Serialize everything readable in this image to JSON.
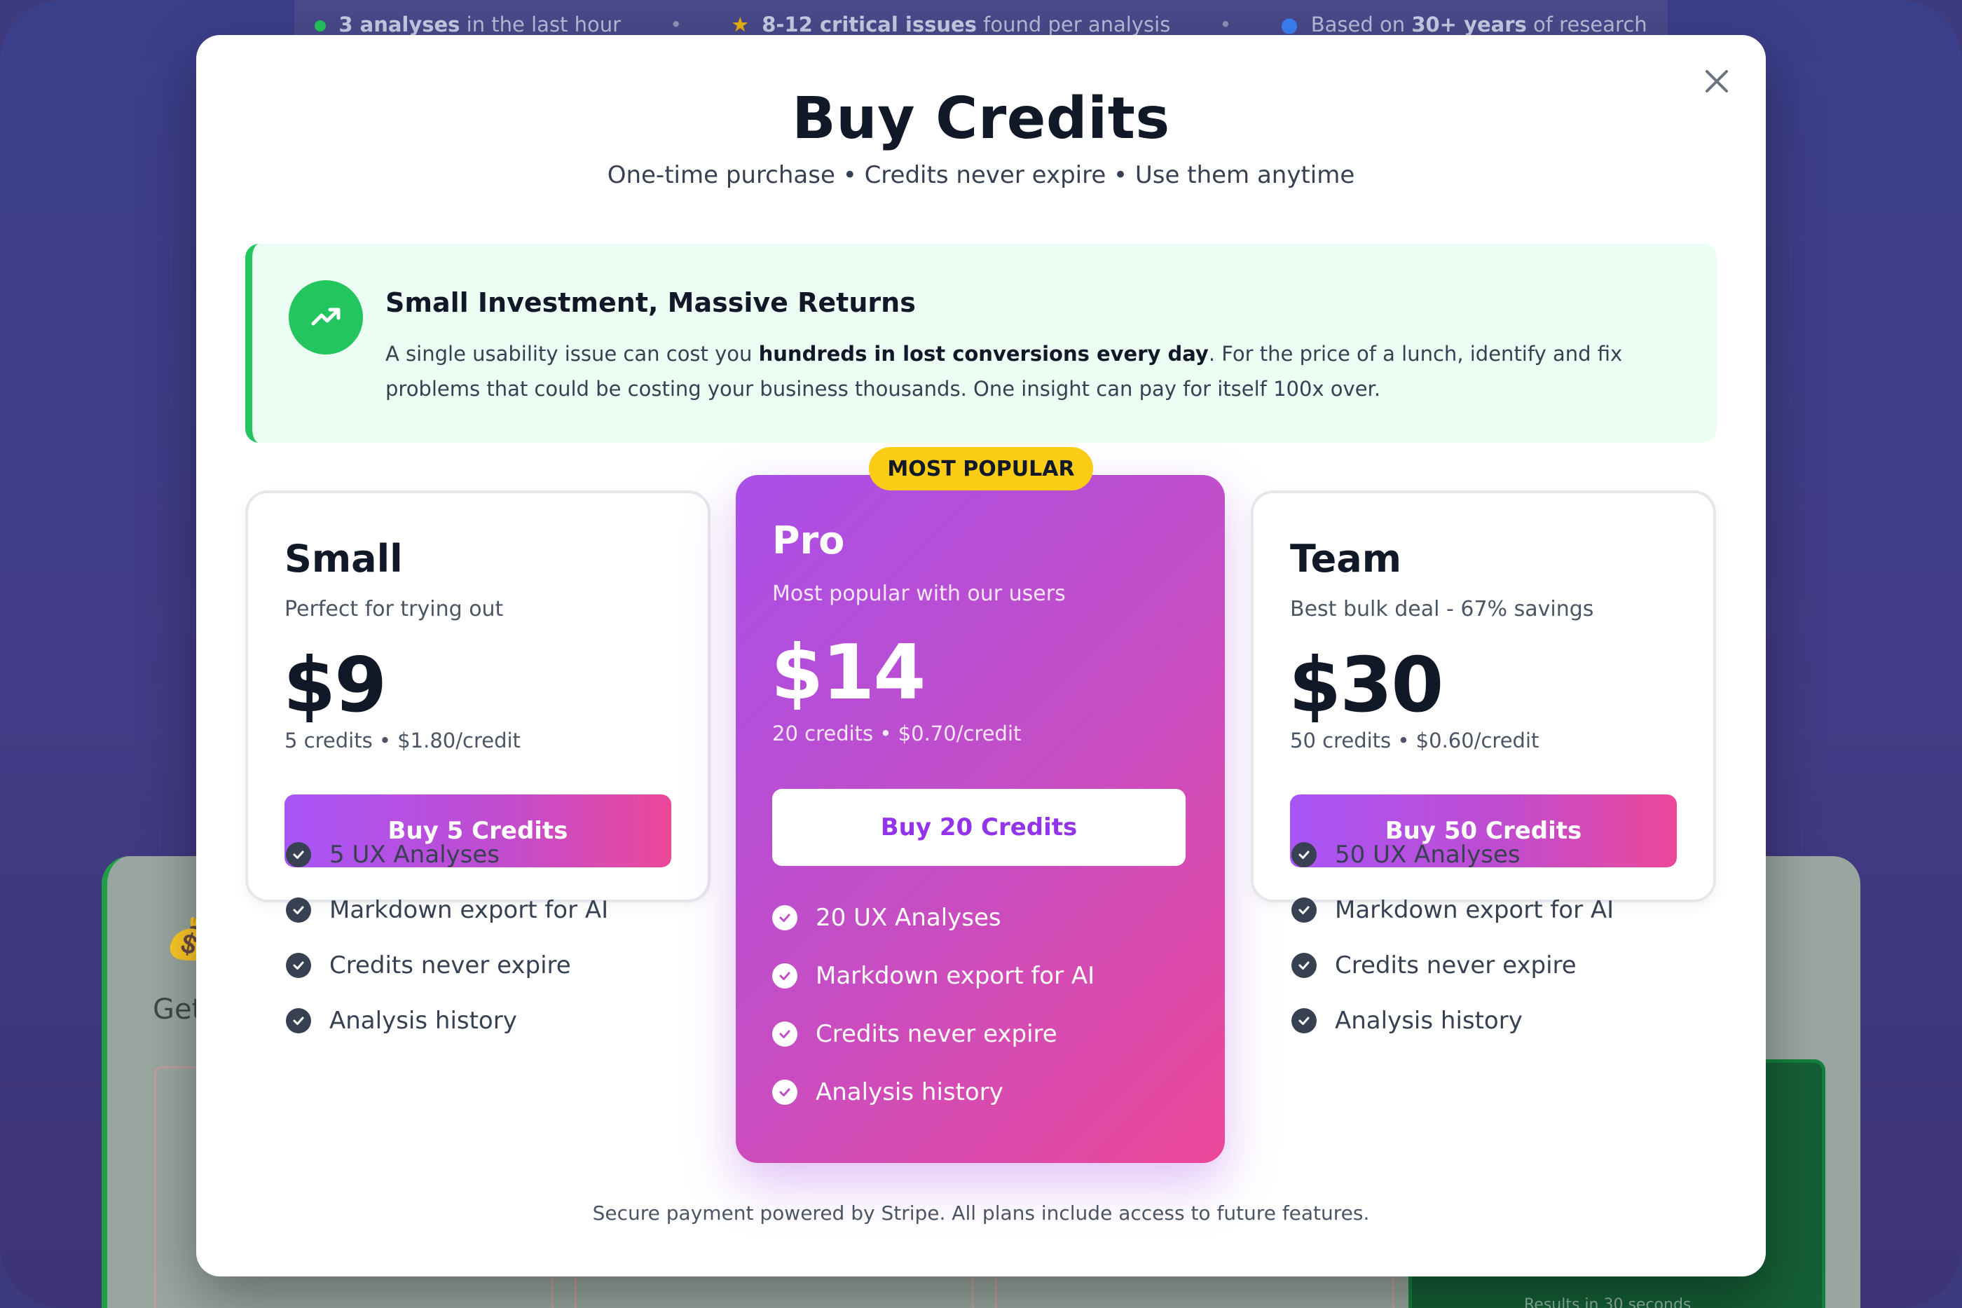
{
  "background": {
    "stats": [
      {
        "value": "3 analyses",
        "text": " in the last hour"
      },
      {
        "value": "8-12 critical issues",
        "text": " found per analysis"
      },
      {
        "prefix": "Based on ",
        "value": "30+ years",
        "text": " of research"
      }
    ],
    "separator": "•",
    "get_text": "Get",
    "results_text": "Results in 30 seconds"
  },
  "modal": {
    "title": "Buy Credits",
    "subtitle": "One-time purchase • Credits never expire • Use them anytime",
    "value_prop": {
      "heading": "Small Investment, Massive Returns",
      "body_pre": "A single usability issue can cost you ",
      "body_bold": "hundreds in lost conversions every day",
      "body_post": ". For the price of a lunch, identify and fix problems that could be costing your business thousands. One insight can pay for itself 100x over."
    },
    "badge": "MOST POPULAR",
    "plans": [
      {
        "name": "Small",
        "description": "Perfect for trying out",
        "price": "$9",
        "credits_line": "5 credits • $1.80/credit",
        "button": "Buy 5 Credits",
        "features": [
          "5 UX Analyses",
          "Markdown export for AI",
          "Credits never expire",
          "Analysis history"
        ]
      },
      {
        "name": "Pro",
        "description": "Most popular with our users",
        "price": "$14",
        "credits_line": "20 credits • $0.70/credit",
        "button": "Buy 20 Credits",
        "features": [
          "20 UX Analyses",
          "Markdown export for AI",
          "Credits never expire",
          "Analysis history"
        ]
      },
      {
        "name": "Team",
        "description": "Best bulk deal - 67% savings",
        "price": "$30",
        "credits_line": "50 credits • $0.60/credit",
        "button": "Buy 50 Credits",
        "features": [
          "50 UX Analyses",
          "Markdown export for AI",
          "Credits never expire",
          "Analysis history"
        ]
      }
    ],
    "footer": "Secure payment powered by Stripe. All plans include access to future features."
  },
  "colors": {
    "accent_purple": "#a855f7",
    "accent_pink": "#ec4899",
    "success_green": "#22c55e",
    "badge_yellow": "#facc15"
  },
  "icons": {
    "close": "close-icon",
    "trend": "trending-up-icon",
    "check": "check-circle-icon"
  }
}
